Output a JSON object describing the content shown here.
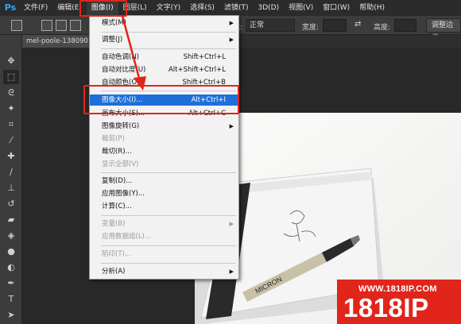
{
  "menubar": {
    "logo": "Ps",
    "items": [
      "文件(F)",
      "编辑(E)",
      "图像(I)",
      "图层(L)",
      "文字(Y)",
      "选择(S)",
      "滤镜(T)",
      "3D(D)",
      "视图(V)",
      "窗口(W)",
      "帮助(H)"
    ],
    "active_index": 2
  },
  "options_bar": {
    "style_label": "样式:",
    "style_value": "正常",
    "width_label": "宽度:",
    "height_label": "高度:",
    "refine_button": "调整边缘"
  },
  "document": {
    "tab_title": "mel-poole-138090"
  },
  "image_menu": {
    "items": [
      {
        "label": "模式(M)",
        "shortcut": "",
        "submenu": true,
        "disabled": false
      },
      {
        "label": "调整(J)",
        "shortcut": "",
        "submenu": true,
        "disabled": false
      },
      {
        "label": "自动色调(N)",
        "shortcut": "Shift+Ctrl+L",
        "submenu": false,
        "disabled": false
      },
      {
        "label": "自动对比度(U)",
        "shortcut": "Alt+Shift+Ctrl+L",
        "submenu": false,
        "disabled": false
      },
      {
        "label": "自动颜色(O)",
        "shortcut": "Shift+Ctrl+B",
        "submenu": false,
        "disabled": false
      },
      {
        "label": "图像大小(I)...",
        "shortcut": "Alt+Ctrl+I",
        "submenu": false,
        "disabled": false,
        "highlighted": true
      },
      {
        "label": "画布大小(S)...",
        "shortcut": "Alt+Ctrl+C",
        "submenu": false,
        "disabled": false
      },
      {
        "label": "图像旋转(G)",
        "shortcut": "",
        "submenu": true,
        "disabled": false
      },
      {
        "label": "裁剪(P)",
        "shortcut": "",
        "submenu": false,
        "disabled": true
      },
      {
        "label": "裁切(R)...",
        "shortcut": "",
        "submenu": false,
        "disabled": false
      },
      {
        "label": "显示全部(V)",
        "shortcut": "",
        "submenu": false,
        "disabled": true
      },
      {
        "label": "复制(D)...",
        "shortcut": "",
        "submenu": false,
        "disabled": false
      },
      {
        "label": "应用图像(Y)...",
        "shortcut": "",
        "submenu": false,
        "disabled": false
      },
      {
        "label": "计算(C)...",
        "shortcut": "",
        "submenu": false,
        "disabled": false
      },
      {
        "label": "变量(B)",
        "shortcut": "",
        "submenu": true,
        "disabled": true
      },
      {
        "label": "应用数据组(L)...",
        "shortcut": "",
        "submenu": false,
        "disabled": true
      },
      {
        "label": "陷印(T)...",
        "shortcut": "",
        "submenu": false,
        "disabled": true
      },
      {
        "label": "分析(A)",
        "shortcut": "",
        "submenu": true,
        "disabled": false
      }
    ]
  },
  "watermark": {
    "url": "WWW.1818IP.COM",
    "logo": "1818IP"
  },
  "colors": {
    "accent_highlight": "#1e6fd9",
    "annotation_red": "#e1251b",
    "ps_blue": "#31a8ff"
  }
}
